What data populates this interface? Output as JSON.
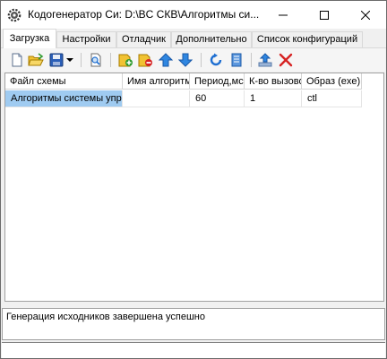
{
  "window": {
    "title": "Кодогенератор Си: D:\\BC СКВ\\Алгоритмы си..."
  },
  "tabs": [
    {
      "label": "Загрузка",
      "active": true
    },
    {
      "label": "Настройки",
      "active": false
    },
    {
      "label": "Отладчик",
      "active": false
    },
    {
      "label": "Дополнительно",
      "active": false
    },
    {
      "label": "Список конфигураций",
      "active": false
    }
  ],
  "toolbar": {
    "icons": [
      "new-file-icon",
      "open-folder-icon",
      "save-icon",
      "dropdown-arrow-icon",
      "find-icon",
      "add-icon",
      "remove-icon",
      "move-up-icon",
      "move-down-icon",
      "refresh-icon",
      "document-icon",
      "export-icon",
      "delete-icon"
    ]
  },
  "table": {
    "columns": [
      "Файл схемы",
      "Имя алгоритм",
      "Период,мс",
      "К-во вызово",
      "Образ (exe)"
    ],
    "rows": [
      [
        "Алгоритмы системы упр",
        "",
        "60",
        "1",
        "ctl"
      ]
    ]
  },
  "status": {
    "message": "Генерация исходников завершена успешно"
  },
  "colors": {
    "selection": "#9fcbf1",
    "icon_blue": "#1f6fd1",
    "icon_green": "#2e9b2e",
    "delete_red": "#d62222"
  }
}
